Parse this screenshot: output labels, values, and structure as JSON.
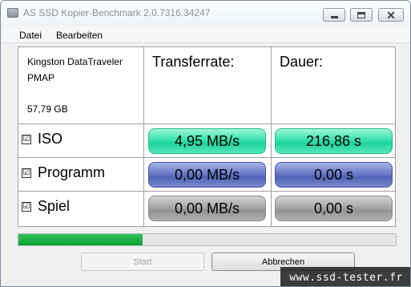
{
  "window": {
    "title": "AS SSD Kopier-Benchmark 2.0.7316.34247"
  },
  "menu": {
    "items": [
      "Datei",
      "Bearbeiten"
    ]
  },
  "device": {
    "name_line1": "Kingston DataTraveler",
    "name_line2": "PMAP",
    "size": "57,79 GB"
  },
  "columns": {
    "transfer": "Transferrate:",
    "duration": "Dauer:"
  },
  "rows": [
    {
      "label": "ISO",
      "checked": true,
      "transfer": "4,95 MB/s",
      "duration": "216,86 s",
      "color": "#2fdca6"
    },
    {
      "label": "Programm",
      "checked": true,
      "transfer": "0,00 MB/s",
      "duration": "0,00 s",
      "color": "#5a6bbb"
    },
    {
      "label": "Spiel",
      "checked": true,
      "transfer": "0,00 MB/s",
      "duration": "0,00 s",
      "color": "#9e9e9e"
    }
  ],
  "checkbox_glyph": "☑",
  "progress": {
    "fraction": 0.33,
    "color": "#1aae40"
  },
  "buttons": {
    "start": "Start",
    "cancel": "Abbrechen"
  },
  "watermark": "www.ssd-tester.fr"
}
